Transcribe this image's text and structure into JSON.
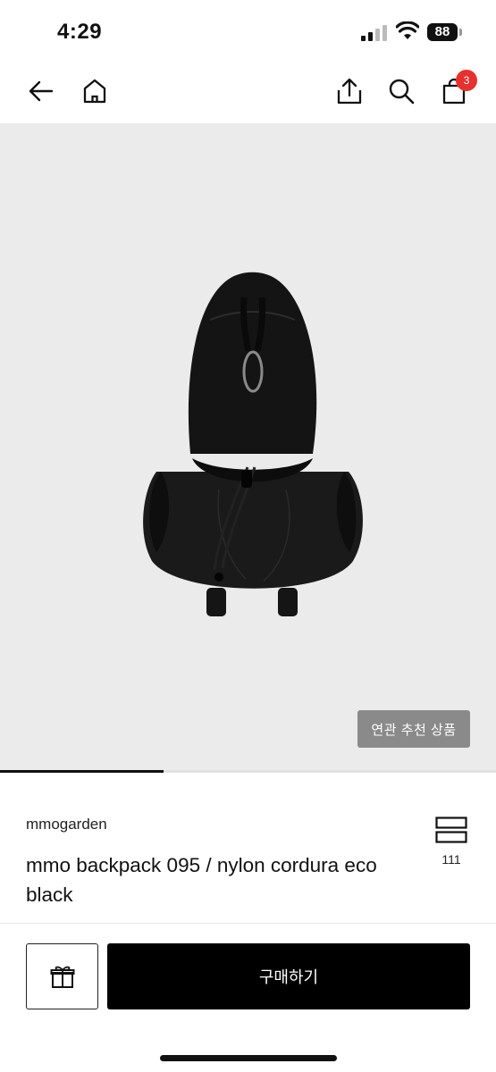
{
  "status_bar": {
    "time": "4:29",
    "battery": "88"
  },
  "nav": {
    "icons": [
      "back-arrow-icon",
      "home-icon",
      "share-icon",
      "search-icon",
      "shopping-bag-icon"
    ],
    "cart_count": "3"
  },
  "hero": {
    "image_subject": "black nylon backpack",
    "related_button_label": "연관 추천 상품",
    "gallery_progress": 0.33
  },
  "product": {
    "brand": "mmogarden",
    "title": "mmo backpack 095 / nylon cordura eco black",
    "like_count": "111"
  },
  "actions": {
    "gift_icon": "gift-icon",
    "buy_label": "구매하기"
  },
  "colors": {
    "badge": "#e8302e",
    "buy_button": "#000000",
    "hero_background": "#ebebeb"
  }
}
